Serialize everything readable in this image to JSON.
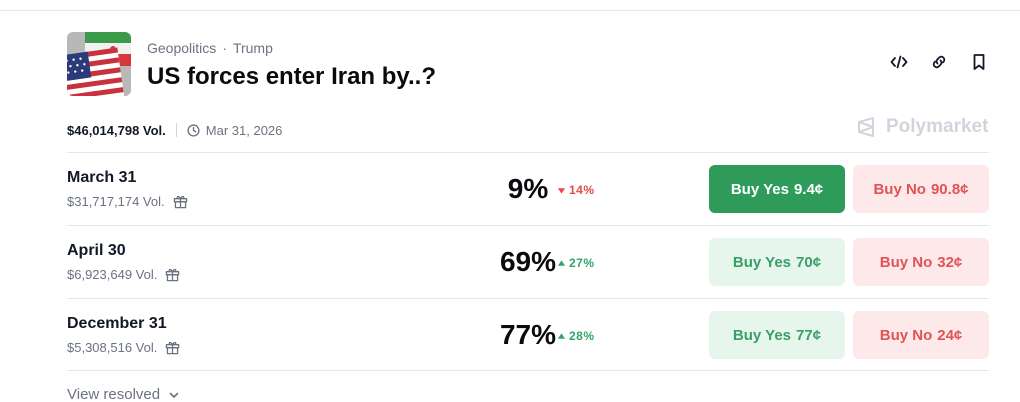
{
  "market": {
    "breadcrumb": [
      "Geopolitics",
      "Trump"
    ],
    "breadcrumb_separator": "·",
    "title": "US forces enter Iran by..?",
    "total_volume": "$46,014,798 Vol.",
    "end_date": "Mar 31, 2026",
    "brand": "Polymarket",
    "thumbnail_icon": "us-iran-flags-image"
  },
  "actions": {
    "embed_icon": "code-icon",
    "link_icon": "link-icon",
    "bookmark_icon": "bookmark-icon"
  },
  "outcomes": [
    {
      "date": "March 31",
      "volume": "$31,717,174 Vol.",
      "percent": "9%",
      "change": "14%",
      "change_direction": "down",
      "yes_label": "Buy Yes",
      "yes_price": "9.4¢",
      "no_label": "Buy No",
      "no_price": "90.8¢",
      "yes_highlighted": true
    },
    {
      "date": "April 30",
      "volume": "$6,923,649 Vol.",
      "percent": "69%",
      "change": "27%",
      "change_direction": "up",
      "yes_label": "Buy Yes",
      "yes_price": "70¢",
      "no_label": "Buy No",
      "no_price": "32¢",
      "yes_highlighted": false
    },
    {
      "date": "December 31",
      "volume": "$5,308,516 Vol.",
      "percent": "77%",
      "change": "28%",
      "change_direction": "up",
      "yes_label": "Buy Yes",
      "yes_price": "77¢",
      "no_label": "Buy No",
      "no_price": "24¢",
      "yes_highlighted": false
    }
  ],
  "footer": {
    "view_resolved": "View resolved"
  },
  "colors": {
    "yes_primary": "#2f9b5a",
    "yes_light": "#e6f6ec",
    "no_light": "#fde9e9",
    "up": "#30a46c",
    "down": "#e5484d"
  }
}
